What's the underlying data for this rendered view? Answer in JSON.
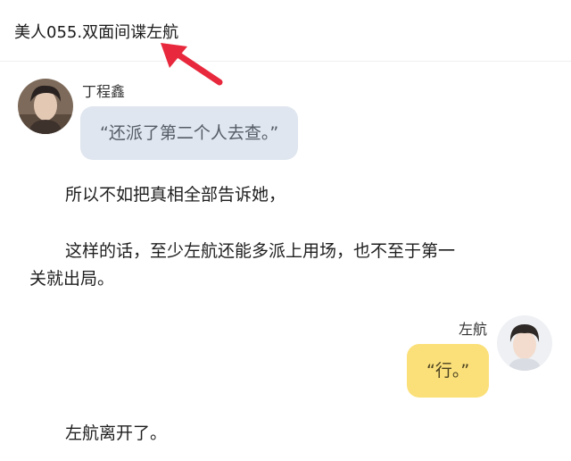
{
  "header": {
    "chapter_title": "美人055.双面间谍左航"
  },
  "messages": [
    {
      "speaker": "丁程鑫",
      "text": "“还派了第二个人去查。”",
      "side": "left",
      "bubble_color": "#dfe6ef"
    },
    {
      "speaker": "左航",
      "text": "“行。”",
      "side": "right",
      "bubble_color": "#fbe07a"
    }
  ],
  "paragraphs": [
    "所以不如把真相全部告诉她，",
    "这样的话，至少左航还能多派上用场，也不至于第一",
    "关就出局。",
    "左航离开了。"
  ],
  "colors": {
    "annotation_arrow": "#e8283c"
  }
}
